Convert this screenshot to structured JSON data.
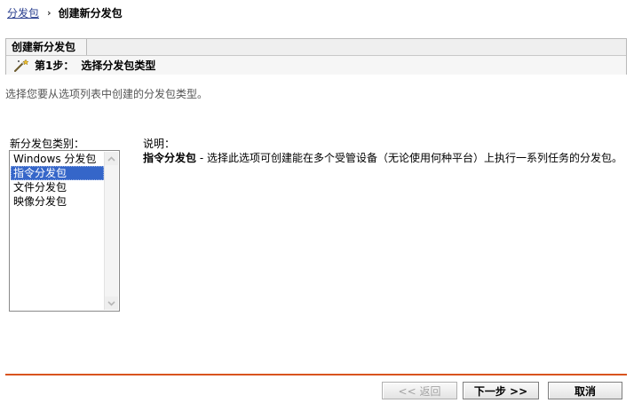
{
  "breadcrumb": {
    "parent": "分发包",
    "separator": "›",
    "current": "创建新分发包"
  },
  "wizard": {
    "tab_label": "创建新分发包",
    "step_number": "第1步：",
    "step_title": "选择分发包类型",
    "step_icon": "magic-wand-icon"
  },
  "instruction": "选择您要从选项列表中创建的分发包类型。",
  "type_selector": {
    "label": "新分发包类别：",
    "options": [
      "Windows 分发包",
      "指令分发包",
      "文件分发包",
      "映像分发包"
    ],
    "selected": "指令分发包"
  },
  "description": {
    "label": "说明：",
    "name": "指令分发包",
    "text": " - 选择此选项可创建能在多个受管设备（无论使用何种平台）上执行一系列任务的分发包。"
  },
  "buttons": {
    "back": "<< 返回",
    "next": "下一步 >>",
    "cancel": "取消"
  },
  "colors": {
    "divider": "#d9541e",
    "selection": "#3566c9",
    "link": "#2a3f8f"
  }
}
